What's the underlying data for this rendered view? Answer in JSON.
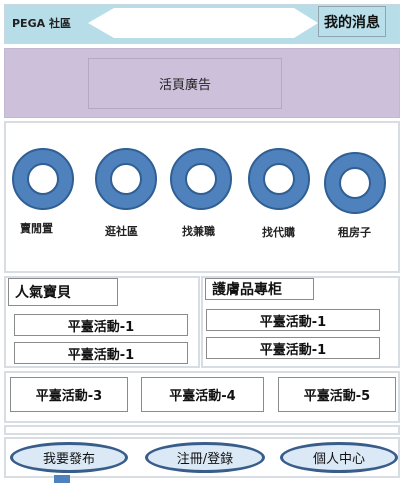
{
  "header": {
    "brand": "PEGA 社區",
    "my_messages": "我的消息"
  },
  "banner": {
    "ad_text": "活頁廣告"
  },
  "categories": [
    {
      "label": "賣閒置"
    },
    {
      "label": "逛社區"
    },
    {
      "label": "找兼職"
    },
    {
      "label": "找代購"
    },
    {
      "label": "租房子"
    }
  ],
  "popular": {
    "title": "人氣寶貝",
    "activities": [
      "平臺活動-1",
      "平臺活動-1"
    ]
  },
  "skincare": {
    "title": "護膚品專柜",
    "activities": [
      "平臺活動-1",
      "平臺活動-1"
    ]
  },
  "activities_row": [
    "平臺活動-3",
    "平臺活動-4",
    "平臺活動-5"
  ],
  "bottom_nav": {
    "post": "我要發布",
    "register_login": "注冊/登錄",
    "profile": "個人中心"
  },
  "colors": {
    "header_bg": "#b7dde8",
    "banner_bg": "#ccc0da",
    "ring_fill": "#4f81bd",
    "ring_stroke": "#2f5f93",
    "oval_stroke": "#385d8a",
    "oval_fill": "#dbe8f5"
  }
}
